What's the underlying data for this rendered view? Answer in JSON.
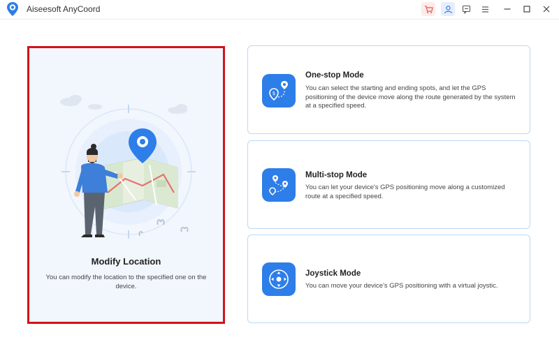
{
  "window": {
    "title": "Aiseesoft AnyCoord",
    "buttons": {
      "cart": "cart-icon",
      "user": "user-icon",
      "feedback": "feedback-icon",
      "menu": "menu-icon",
      "minimize": "minimize-icon",
      "maximize": "maximize-icon",
      "close": "close-icon"
    }
  },
  "colors": {
    "accent": "#2d7ee8",
    "highlight_border": "#d4121a",
    "card_border": "#bcd7f3"
  },
  "modify_location": {
    "title": "Modify Location",
    "description": "You can modify the location to the specified one on the device."
  },
  "modes": [
    {
      "title": "One-stop Mode",
      "description": "You can select the starting and ending spots, and let the GPS positioning of the device move along the route generated by the system at a specified speed.",
      "icon": "route-pin-icon"
    },
    {
      "title": "Multi-stop Mode",
      "description": "You can let your device's GPS positioning move along a customized route at a specified speed.",
      "icon": "multi-pin-route-icon"
    },
    {
      "title": "Joystick Mode",
      "description": "You can move your device's GPS positioning with a virtual joystic.",
      "icon": "joystick-icon"
    }
  ]
}
